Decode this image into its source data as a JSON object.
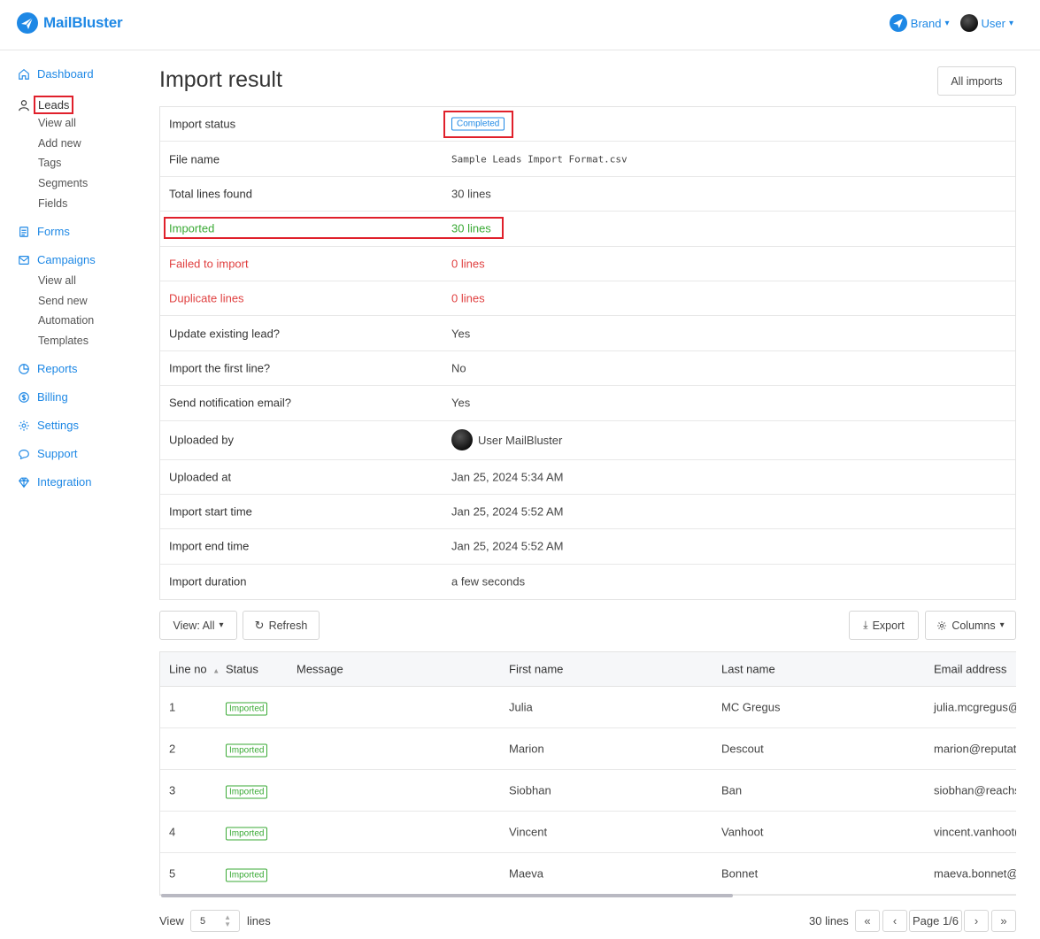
{
  "header": {
    "app_name": "MailBluster",
    "brand_label": "Brand",
    "user_label": "User"
  },
  "sidebar": {
    "dashboard": "Dashboard",
    "leads": "Leads",
    "leads_sub": [
      "View all",
      "Add new",
      "Tags",
      "Segments",
      "Fields"
    ],
    "forms": "Forms",
    "campaigns": "Campaigns",
    "campaigns_sub": [
      "View all",
      "Send new",
      "Automation",
      "Templates"
    ],
    "reports": "Reports",
    "billing": "Billing",
    "settings": "Settings",
    "support": "Support",
    "integration": "Integration"
  },
  "main": {
    "title": "Import result",
    "all_imports_label": "All imports",
    "info": {
      "import_status_label": "Import status",
      "import_status_value": "Completed",
      "file_name_label": "File name",
      "file_name_value": "Sample Leads Import Format.csv",
      "total_lines_label": "Total lines found",
      "total_lines_value": "30 lines",
      "imported_label": "Imported",
      "imported_value": "30 lines",
      "failed_label": "Failed to import",
      "failed_value": "0 lines",
      "duplicate_label": "Duplicate lines",
      "duplicate_value": "0 lines",
      "update_existing_label": "Update existing lead?",
      "update_existing_value": "Yes",
      "import_first_label": "Import the first line?",
      "import_first_value": "No",
      "send_notification_label": "Send notification email?",
      "send_notification_value": "Yes",
      "uploaded_by_label": "Uploaded by",
      "uploaded_by_value": "User MailBluster",
      "uploaded_at_label": "Uploaded at",
      "uploaded_at_value": "Jan 25, 2024 5:34 AM",
      "start_time_label": "Import start time",
      "start_time_value": "Jan 25, 2024 5:52 AM",
      "end_time_label": "Import end time",
      "end_time_value": "Jan 25, 2024 5:52 AM",
      "duration_label": "Import duration",
      "duration_value": "a few seconds"
    },
    "toolbar": {
      "view_label": "View: All",
      "refresh_label": "Refresh",
      "export_label": "Export",
      "columns_label": "Columns"
    },
    "table": {
      "headers": {
        "line_no": "Line no",
        "status": "Status",
        "message": "Message",
        "first_name": "First name",
        "last_name": "Last name",
        "email": "Email address"
      },
      "rows": [
        {
          "line": "1",
          "status": "Imported",
          "message": "",
          "first": "Julia",
          "last": "MC Gregus",
          "email": "julia.mcgregus@"
        },
        {
          "line": "2",
          "status": "Imported",
          "message": "",
          "first": "Marion",
          "last": "Descout",
          "email": "marion@reputat"
        },
        {
          "line": "3",
          "status": "Imported",
          "message": "",
          "first": "Siobhan",
          "last": "Ban",
          "email": "siobhan@reachs"
        },
        {
          "line": "4",
          "status": "Imported",
          "message": "",
          "first": "Vincent",
          "last": "Vanhoot",
          "email": "vincent.vanhoot("
        },
        {
          "line": "5",
          "status": "Imported",
          "message": "",
          "first": "Maeva",
          "last": "Bonnet",
          "email": "maeva.bonnet@"
        }
      ]
    },
    "footer": {
      "view_label": "View",
      "per_page": "5",
      "lines_label": "lines",
      "total_lines": "30 lines",
      "page_label": "Page 1/6"
    }
  },
  "colors": {
    "accent": "#1e88e5",
    "success": "#3aaa35",
    "danger": "#e04040",
    "highlight": "#e0202b"
  }
}
